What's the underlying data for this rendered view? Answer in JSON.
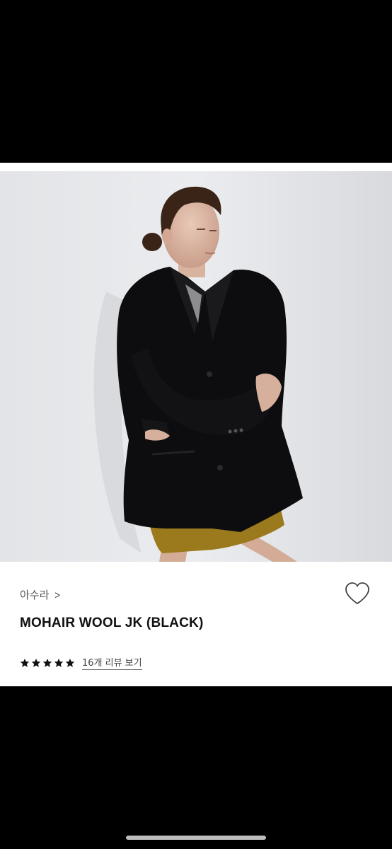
{
  "product": {
    "brand": "아수라",
    "title": "MOHAIR WOOL JK (BLACK)",
    "rating": 5,
    "review_link": "16개 리뷰 보기"
  },
  "icons": {
    "brand_chevron": "chevron-right-icon",
    "wishlist": "heart-outline-icon",
    "star": "star-filled-icon"
  },
  "image": {
    "subject": "model wearing black mohair wool jacket"
  },
  "colors": {
    "background": "#000000",
    "card": "#ffffff",
    "text_primary": "#111111",
    "text_secondary": "#555555"
  }
}
